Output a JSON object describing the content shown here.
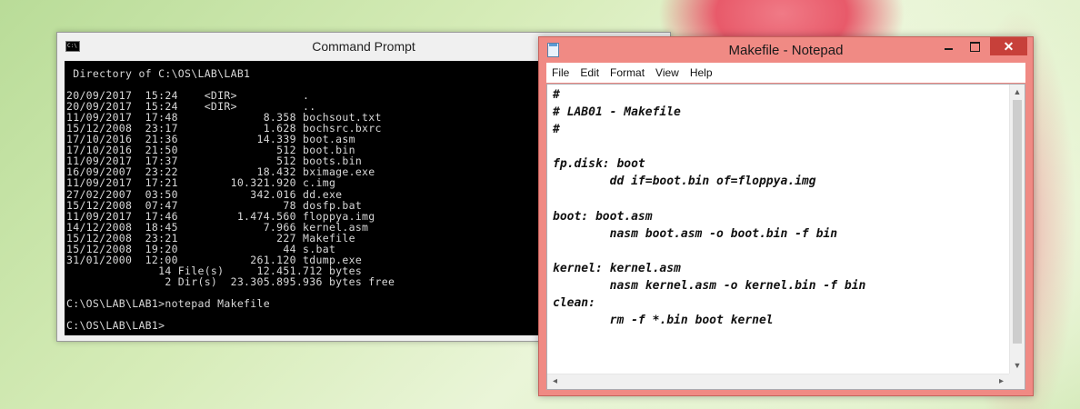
{
  "cmd": {
    "title": "Command Prompt",
    "output": " Directory of C:\\OS\\LAB\\LAB1\n\n20/09/2017  15:24    <DIR>          .\n20/09/2017  15:24    <DIR>          ..\n11/09/2017  17:48             8.358 bochsout.txt\n15/12/2008  23:17             1.628 bochsrc.bxrc\n17/10/2016  21:36            14.339 boot.asm\n17/10/2016  21:50               512 boot.bin\n11/09/2017  17:37               512 boots.bin\n16/09/2007  23:22            18.432 bximage.exe\n11/09/2017  17:21        10.321.920 c.img\n27/02/2007  03:50           342.016 dd.exe\n15/12/2008  07:47                78 dosfp.bat\n11/09/2017  17:46         1.474.560 floppya.img\n14/12/2008  18:45             7.966 kernel.asm\n15/12/2008  23:21               227 Makefile\n15/12/2008  19:20                44 s.bat\n31/01/2000  12:00           261.120 tdump.exe\n              14 File(s)     12.451.712 bytes\n               2 Dir(s)  23.305.895.936 bytes free\n\nC:\\OS\\LAB\\LAB1>notepad Makefile\n\nC:\\OS\\LAB\\LAB1>"
  },
  "notepad": {
    "title": "Makefile - Notepad",
    "controls": {
      "minimize": "",
      "maximize": "",
      "close": "✕"
    },
    "menu": [
      "File",
      "Edit",
      "Format",
      "View",
      "Help"
    ],
    "content": "#\n# LAB01 - Makefile\n#\n\nfp.disk: boot\n        dd if=boot.bin of=floppya.img\n\nboot: boot.asm\n        nasm boot.asm -o boot.bin -f bin\n\nkernel: kernel.asm\n        nasm kernel.asm -o kernel.bin -f bin\nclean:\n        rm -f *.bin boot kernel"
  },
  "icons": {
    "cmd": "console-icon",
    "notepad": "notepad-icon"
  }
}
